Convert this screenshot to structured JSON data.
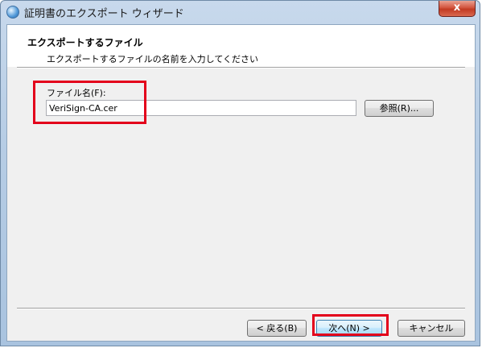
{
  "window": {
    "title": "証明書のエクスポート ウィザード",
    "close_label": "x",
    "icon": "certificate-icon"
  },
  "header": {
    "title": "エクスポートするファイル",
    "subtitle": "エクスポートするファイルの名前を入力してください"
  },
  "form": {
    "filename_label": "ファイル名(F):",
    "filename_value": "VeriSign-CA.cer",
    "browse_label": "参照(R)..."
  },
  "footer": {
    "back_label": "< 戻る(B)",
    "next_label": "次へ(N) >",
    "cancel_label": "キャンセル"
  },
  "colors": {
    "highlight": "#e3001b",
    "close_button": "#c23a22"
  }
}
